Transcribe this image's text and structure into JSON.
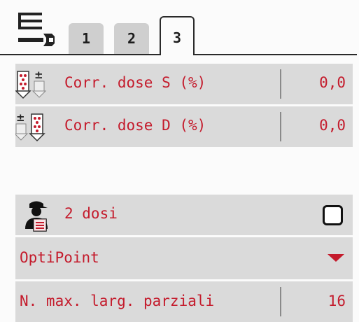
{
  "tabs": [
    {
      "label": "1",
      "active": false
    },
    {
      "label": "2",
      "active": false
    },
    {
      "label": "3",
      "active": true
    }
  ],
  "rows": {
    "corr_s": {
      "label": "Corr. dose S (%)",
      "value": "0,0",
      "icon": "dose-left-icon"
    },
    "corr_d": {
      "label": "Corr. dose D (%)",
      "value": "0,0",
      "icon": "dose-right-icon"
    },
    "two_doses": {
      "label": "2 dosi",
      "checked": false,
      "icon": "operator-icon"
    },
    "optipoint": {
      "label": "OptiPoint",
      "icon": "chevron-down-icon"
    },
    "max_sections": {
      "label": "N. max. larg. parziali",
      "value": "16"
    }
  },
  "colors": {
    "accent_red": "#c41b2c",
    "row_bg": "#dadada",
    "background": "#fbfbfb"
  }
}
